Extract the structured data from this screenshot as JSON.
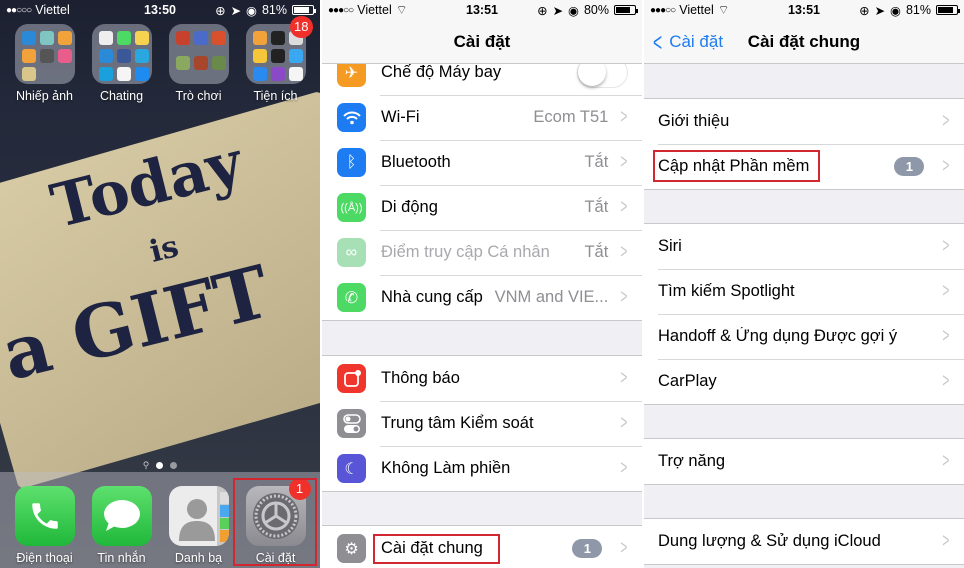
{
  "home": {
    "status": {
      "signal": "●●○○○",
      "carrier": "Viettel",
      "time": "13:50",
      "battery": "81%",
      "battery_level": 0.81
    },
    "folders": [
      {
        "label": "Nhiếp ảnh",
        "badge": ""
      },
      {
        "label": "Chating",
        "badge": ""
      },
      {
        "label": "Trò chơi",
        "badge": ""
      },
      {
        "label": "Tiện ích",
        "badge": "18"
      }
    ],
    "wallpaper_text": {
      "line1": "Today",
      "line2": "is",
      "line3": "a GIFT"
    },
    "page_dots": {
      "search": "⚲",
      "count": 2,
      "active": 0
    },
    "dock": [
      {
        "label": "Điện thoại",
        "icon": "phone-icon",
        "badge": ""
      },
      {
        "label": "Tin nhắn",
        "icon": "messages-icon",
        "badge": ""
      },
      {
        "label": "Danh bạ",
        "icon": "contacts-icon",
        "badge": ""
      },
      {
        "label": "Cài đặt",
        "icon": "settings-icon",
        "badge": "1"
      }
    ]
  },
  "settings": {
    "status": {
      "signal": "●●●○○",
      "carrier": "Viettel",
      "time": "13:51",
      "battery": "80%",
      "battery_level": 0.8
    },
    "title": "Cài đặt",
    "group1": [
      {
        "label": "Chế độ Máy bay",
        "value": "",
        "icon": "✈",
        "color": "#f59a23",
        "toggle": false
      },
      {
        "label": "Wi-Fi",
        "value": "Ecom T51",
        "icon": "wifi",
        "color": "#1e7cf2"
      },
      {
        "label": "Bluetooth",
        "value": "Tắt",
        "icon": "ᛒ",
        "color": "#1e7cf2"
      },
      {
        "label": "Di động",
        "value": "Tắt",
        "icon": "((A))",
        "color": "#4cd964"
      },
      {
        "label": "Điểm truy cập Cá nhân",
        "value": "Tắt",
        "icon": "∞",
        "color": "#a8e0b6",
        "disabled": true
      },
      {
        "label": "Nhà cung cấp",
        "value": "VNM and VIE...",
        "icon": "✆",
        "color": "#4cd964"
      }
    ],
    "group2": [
      {
        "label": "Thông báo",
        "icon": "□",
        "color": "#f0352c"
      },
      {
        "label": "Trung tâm Kiểm soát",
        "icon": "⊜",
        "color": "#8e8e93"
      },
      {
        "label": "Không Làm phiền",
        "icon": "☾",
        "color": "#5856d6"
      }
    ],
    "group3": [
      {
        "label": "Cài đặt chung",
        "badge": "1",
        "icon": "⚙",
        "color": "#8e8e93"
      }
    ]
  },
  "general": {
    "status": {
      "signal": "●●●○○",
      "carrier": "Viettel",
      "time": "13:51",
      "battery": "81%",
      "battery_level": 0.81
    },
    "back_label": "Cài đặt",
    "title": "Cài đặt chung",
    "group1": [
      {
        "label": "Giới thiệu",
        "badge": ""
      },
      {
        "label": "Cập nhật Phần mềm",
        "badge": "1"
      }
    ],
    "group2": [
      {
        "label": "Siri"
      },
      {
        "label": "Tìm kiếm Spotlight"
      },
      {
        "label": "Handoff & Ứng dụng Được gợi ý"
      },
      {
        "label": "CarPlay"
      }
    ],
    "group3": [
      {
        "label": "Trợ năng"
      }
    ],
    "group4": [
      {
        "label": "Dung lượng & Sử dụng iCloud"
      }
    ]
  }
}
